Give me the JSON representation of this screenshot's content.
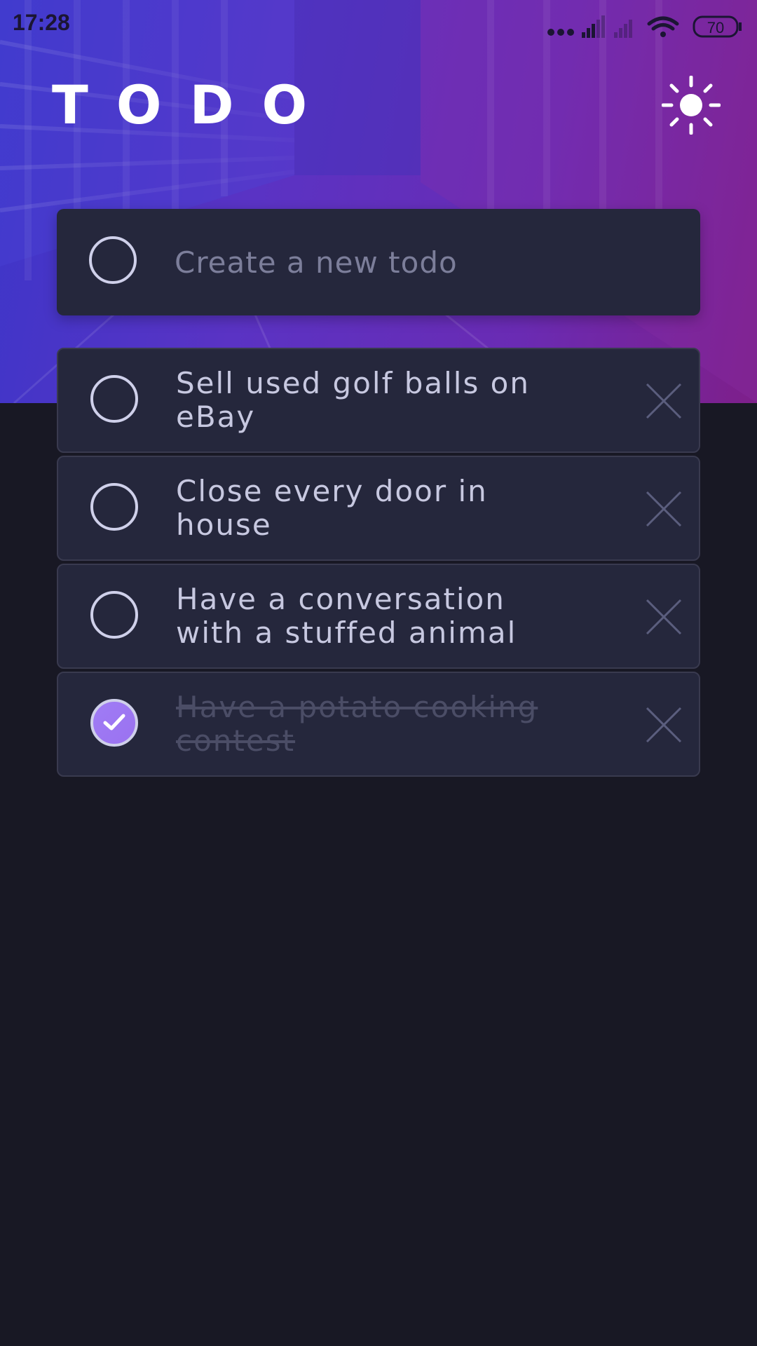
{
  "status_bar": {
    "time": "17:28",
    "battery": "70"
  },
  "header": {
    "title": "TODO",
    "theme_toggle_icon": "sun-icon"
  },
  "new_todo": {
    "placeholder": "Create a new todo",
    "value": ""
  },
  "todos": [
    {
      "text": "Sell used golf balls on eBay",
      "completed": false
    },
    {
      "text": "Close every door in house",
      "completed": false
    },
    {
      "text": "Have a conversation with a stuffed animal",
      "completed": false
    },
    {
      "text": "Have a potato cooking contest",
      "completed": true
    }
  ],
  "colors": {
    "background": "#181824",
    "card": "#25273c",
    "text": "#c7c8e0",
    "completed_text": "#4b4d66",
    "check_gradient_start": "#a07cf5",
    "check_gradient_end": "#9a72f0"
  }
}
